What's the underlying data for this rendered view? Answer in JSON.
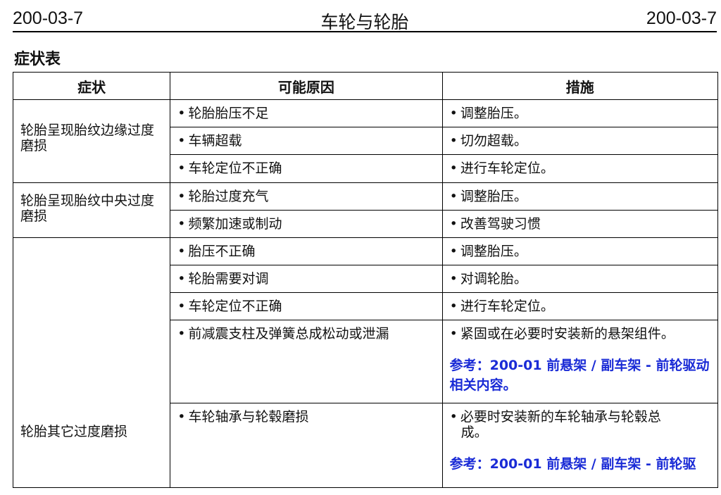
{
  "header": {
    "left": "200-03-7",
    "center": "车轮与轮胎",
    "right": "200-03-7"
  },
  "section_title": "症状表",
  "table": {
    "headers": [
      "症状",
      "可能原因",
      "措施"
    ],
    "groups": [
      {
        "symptom": "轮胎呈现胎纹边缘过度磨损",
        "rows": [
          {
            "cause": "轮胎胎压不足",
            "action": "调整胎压。"
          },
          {
            "cause": "车辆超载",
            "action": "切勿超载。"
          },
          {
            "cause": "车轮定位不正确",
            "action": "进行车轮定位。"
          }
        ]
      },
      {
        "symptom": "轮胎呈现胎纹中央过度磨损",
        "rows": [
          {
            "cause": "轮胎过度充气",
            "action": "调整胎压。"
          },
          {
            "cause": "频繁加速或制动",
            "action": "改善驾驶习惯"
          }
        ]
      },
      {
        "symptom": "轮胎其它过度磨损",
        "rows": [
          {
            "cause": "胎压不正确",
            "action": "调整胎压。"
          },
          {
            "cause": "轮胎需要对调",
            "action": "对调轮胎。"
          },
          {
            "cause": "车轮定位不正确",
            "action": "进行车轮定位。"
          },
          {
            "cause": "前减震支柱及弹簧总成松动或泄漏",
            "action": "紧固或在必要时安装新的悬架组件。",
            "reference": "参考：200-01 前悬架 / 副车架 - 前轮驱动相关内容。"
          },
          {
            "cause": "车轮轴承与轮毂磨损",
            "action_line1": "必要时安装新的车轮轴承与轮毂总",
            "action_line2": "成。",
            "reference": "参考：200-01 前悬架 / 副车架 - 前轮驱"
          }
        ]
      }
    ]
  },
  "bullet": "•",
  "colors": {
    "reference_text": "#1a2bd6",
    "border": "#000000"
  }
}
